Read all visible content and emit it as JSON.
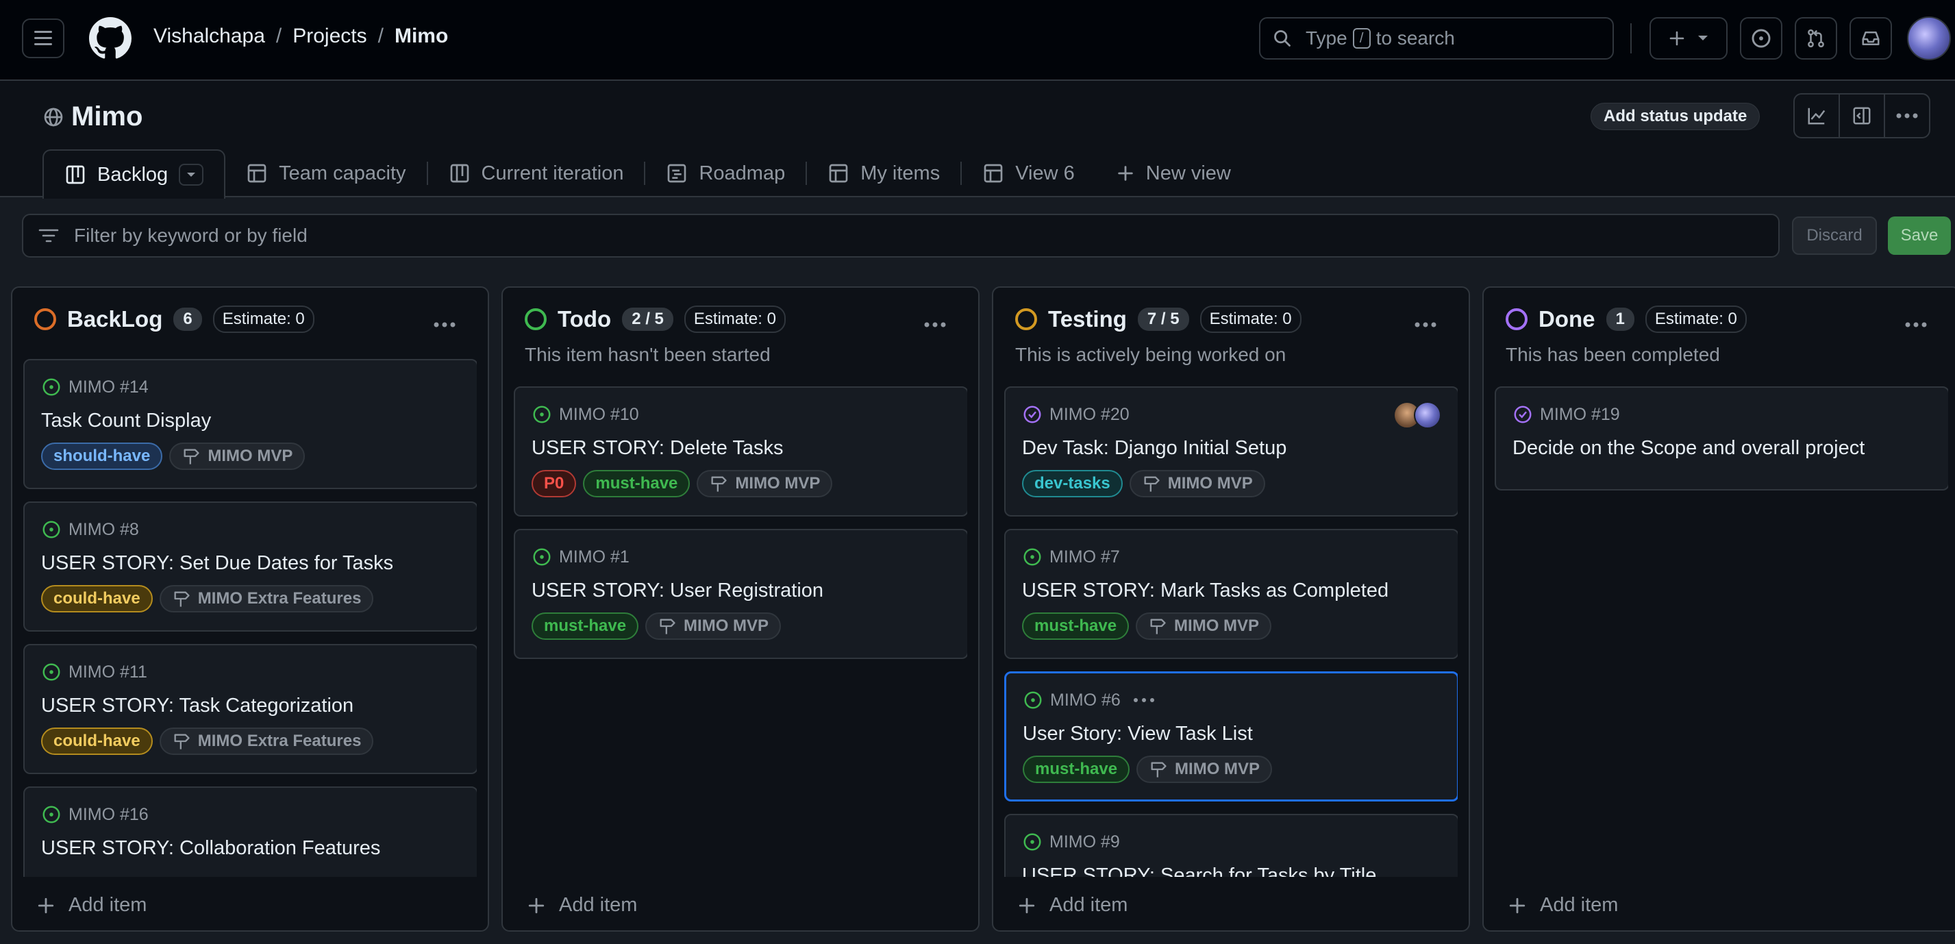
{
  "breadcrumb": {
    "owner": "Vishalchapa",
    "projects": "Projects",
    "current": "Mimo",
    "sep": "/"
  },
  "search": {
    "before": "Type",
    "key": "/",
    "after": "to search"
  },
  "project": {
    "title": "Mimo",
    "status_button": "Add status update"
  },
  "tabs": [
    {
      "label": "Backlog",
      "icon": "board-icon"
    },
    {
      "label": "Team capacity",
      "icon": "table-icon"
    },
    {
      "label": "Current iteration",
      "icon": "board-icon"
    },
    {
      "label": "Roadmap",
      "icon": "roadmap-icon"
    },
    {
      "label": "My items",
      "icon": "table-icon"
    },
    {
      "label": "View 6",
      "icon": "table-icon"
    },
    {
      "label": "New view",
      "icon": "plus-icon"
    }
  ],
  "filter": {
    "placeholder": "Filter by keyword or by field",
    "discard": "Discard",
    "save": "Save"
  },
  "colors": {
    "accent_blue": "#1f6feb",
    "open_green": "#3fb950",
    "closed_purple": "#a371f7",
    "backlog_orange": "#db6d28",
    "testing_yellow": "#d29922"
  },
  "columns": [
    {
      "name": "BackLog",
      "count": "6",
      "estimate": "Estimate: 0",
      "description": "",
      "cards": [
        {
          "id": "MIMO #14",
          "title": "Task Count Display",
          "labels": [
            "should-have"
          ],
          "milestone": "MIMO MVP"
        },
        {
          "id": "MIMO #8",
          "title": "USER STORY: Set Due Dates for Tasks",
          "labels": [
            "could-have"
          ],
          "milestone": "MIMO Extra Features"
        },
        {
          "id": "MIMO #11",
          "title": "USER STORY: Task Categorization",
          "labels": [
            "could-have"
          ],
          "milestone": "MIMO Extra Features"
        },
        {
          "id": "MIMO #16",
          "title": "USER STORY: Collaboration Features",
          "labels": [],
          "milestone": ""
        }
      ],
      "add_item": "Add item"
    },
    {
      "name": "Todo",
      "count": "2 / 5",
      "estimate": "Estimate: 0",
      "description": "This item hasn't been started",
      "cards": [
        {
          "id": "MIMO #10",
          "title": "USER STORY: Delete Tasks",
          "labels": [
            "P0",
            "must-have"
          ],
          "milestone": "MIMO MVP"
        },
        {
          "id": "MIMO #1",
          "title": "USER STORY: User Registration",
          "labels": [
            "must-have"
          ],
          "milestone": "MIMO MVP"
        }
      ],
      "add_item": "Add item"
    },
    {
      "name": "Testing",
      "count": "7 / 5",
      "estimate": "Estimate: 0",
      "description": "This is actively being worked on",
      "cards": [
        {
          "id": "MIMO #20",
          "title": "Dev Task: Django Initial Setup",
          "labels": [
            "dev-tasks"
          ],
          "milestone": "MIMO MVP"
        },
        {
          "id": "MIMO #7",
          "title": "USER STORY: Mark Tasks as Completed",
          "labels": [
            "must-have"
          ],
          "milestone": "MIMO MVP"
        },
        {
          "id": "MIMO #6",
          "title": "User Story: View Task List",
          "labels": [
            "must-have"
          ],
          "milestone": "MIMO MVP"
        },
        {
          "id": "MIMO #9",
          "title": "USER STORY: Search for Tasks by Title",
          "labels": [],
          "milestone": ""
        }
      ],
      "add_item": "Add item"
    },
    {
      "name": "Done",
      "count": "1",
      "estimate": "Estimate: 0",
      "description": "This has been completed",
      "cards": [
        {
          "id": "MIMO #19",
          "title": "Decide on the Scope and overall project",
          "labels": [],
          "milestone": ""
        }
      ],
      "add_item": "Add item"
    }
  ]
}
